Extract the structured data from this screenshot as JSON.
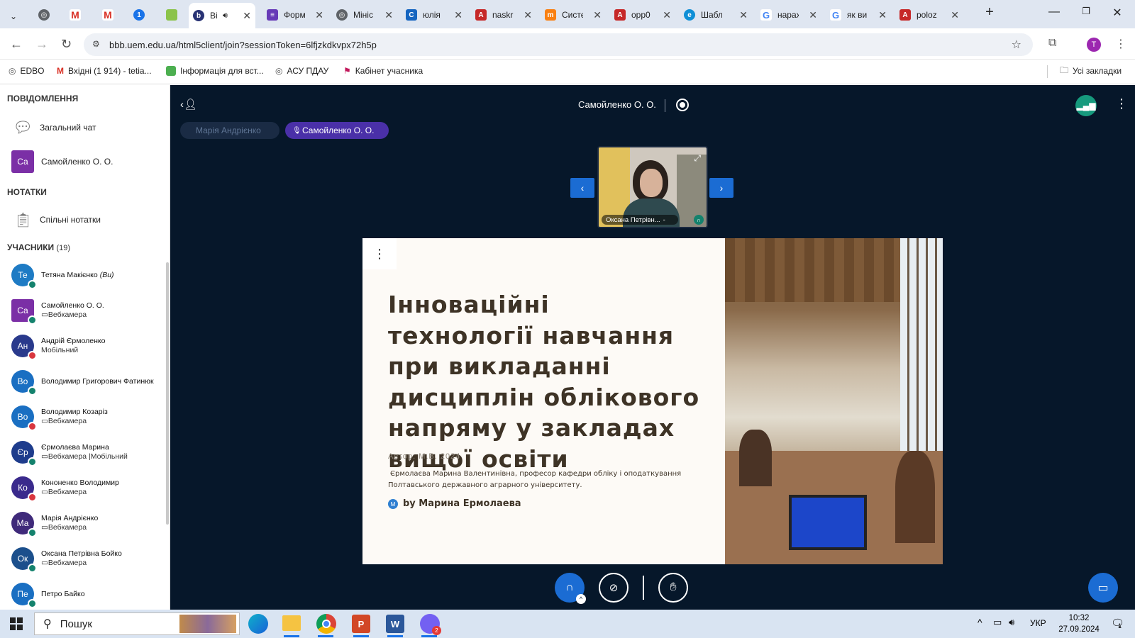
{
  "browser": {
    "tabs": [
      {
        "title": "",
        "icon": "chrome-icon"
      },
      {
        "title": "",
        "icon": "gmail-icon"
      },
      {
        "title": "",
        "icon": "gmail-icon"
      },
      {
        "title": "",
        "icon": "onepassword-icon"
      },
      {
        "title": "",
        "icon": "folder-icon"
      },
      {
        "title": "Ві",
        "icon": "bigbluebutton-icon",
        "active": true
      },
      {
        "title": "Форм",
        "icon": "forms-icon"
      },
      {
        "title": "Мініс",
        "icon": "globe-icon"
      },
      {
        "title": "юлія",
        "icon": "doc-icon"
      },
      {
        "title": "naskr",
        "icon": "pdf-icon"
      },
      {
        "title": "Систе",
        "icon": "moodle-icon"
      },
      {
        "title": "opp0",
        "icon": "pdf-icon"
      },
      {
        "title": "Шабл",
        "icon": "edge-icon"
      },
      {
        "title": "нарах",
        "icon": "google-icon"
      },
      {
        "title": "як ви",
        "icon": "google-icon"
      },
      {
        "title": "poloz",
        "icon": "pdf-icon"
      }
    ],
    "url": "bbb.uem.edu.ua/html5client/join?sessionToken=6lfjzkdkvpx72h5p",
    "profile_initial": "T",
    "bookmarks": [
      {
        "label": "EDBO",
        "icon": "globe-icon"
      },
      {
        "label": "Вхідні (1 914) - tetia...",
        "icon": "gmail-icon"
      },
      {
        "label": "Інформація для вст...",
        "icon": "bookmark-green-icon"
      },
      {
        "label": "АСУ ПДАУ",
        "icon": "globe-icon"
      },
      {
        "label": "Кабінет учасника",
        "icon": "flag-icon"
      }
    ],
    "all_bookmarks": "Усі закладки"
  },
  "sidebar": {
    "messages_header": "ПОВІДОМЛЕННЯ",
    "public_chat": "Загальний чат",
    "private_chat": {
      "initials": "Са",
      "name": "Самойленко О. О."
    },
    "notes_header": "НОТАТКИ",
    "shared_notes": "Спільні нотатки",
    "users_header": "УЧАСНИКИ",
    "users_count": "(19)",
    "users": [
      {
        "initials": "Те",
        "name": "Тетяна Макієнко",
        "you": "(Ви)",
        "sub": "",
        "color": "#1e7bc4",
        "status": "#14826d"
      },
      {
        "initials": "Са",
        "name": "Самойленко О. О.",
        "sub": "▭Вебкамера",
        "color": "#7b2fa6",
        "status": "#14826d",
        "square": true
      },
      {
        "initials": "Ан",
        "name": "Андрій Єрмоленко",
        "sub": "Мобільний",
        "color": "#2a3a8c",
        "status": "#d9363e"
      },
      {
        "initials": "Во",
        "name": "Володимир Григорович Фатинюк",
        "sub": "",
        "color": "#1a6fc2",
        "status": "#14826d"
      },
      {
        "initials": "Во",
        "name": "Володимир Козаріз",
        "sub": "▭Вебкамера",
        "color": "#1a6fc2",
        "status": "#d9363e"
      },
      {
        "initials": "Єр",
        "name": "Єрмолаєва Марина",
        "sub": "▭Вебкамера |Мобільний",
        "color": "#1e3c8c",
        "status": "#14826d"
      },
      {
        "initials": "Ко",
        "name": "Кононенко Володимир",
        "sub": "▭Вебкамера",
        "color": "#3a2a8c",
        "status": "#d9363e"
      },
      {
        "initials": "Ма",
        "name": "Марія Андрієнко",
        "sub": "▭Вебкамера",
        "color": "#3f2a7a",
        "status": "#14826d"
      },
      {
        "initials": "Ок",
        "name": "Оксана Петрівна Бойко",
        "sub": "▭Вебкамера",
        "color": "#1b4f8c",
        "status": "#14826d"
      },
      {
        "initials": "Пе",
        "name": "Петро Байко",
        "sub": "",
        "color": "#1a6fc2",
        "status": "#14826d"
      }
    ]
  },
  "meeting": {
    "presenter_title": "Самойленко О. О.",
    "talking": [
      {
        "name": "Марія Андрієнко",
        "active": false
      },
      {
        "name": "Самойленко О. О.",
        "active": true
      }
    ],
    "webcam_label": "Оксана Петрівн...",
    "slide": {
      "title": "Інноваційні технології навчання при викладанні дисциплін облікового напряму у закладах вищої освіти",
      "overlay": "Автор:  М.В. 2024",
      "author_line1": "Єрмолаєва Марина Валентинівна, професор кафедри    обліку і оподаткування",
      "author_line2": "Полтавського державного аграрного університету.",
      "badge": "M",
      "by_line": "by Марина Ермолаева"
    }
  },
  "taskbar": {
    "search": "Пошук",
    "lang": "УКР",
    "time": "10:32",
    "date": "27.09.2024",
    "notif_count": "1",
    "viber_count": "2"
  }
}
